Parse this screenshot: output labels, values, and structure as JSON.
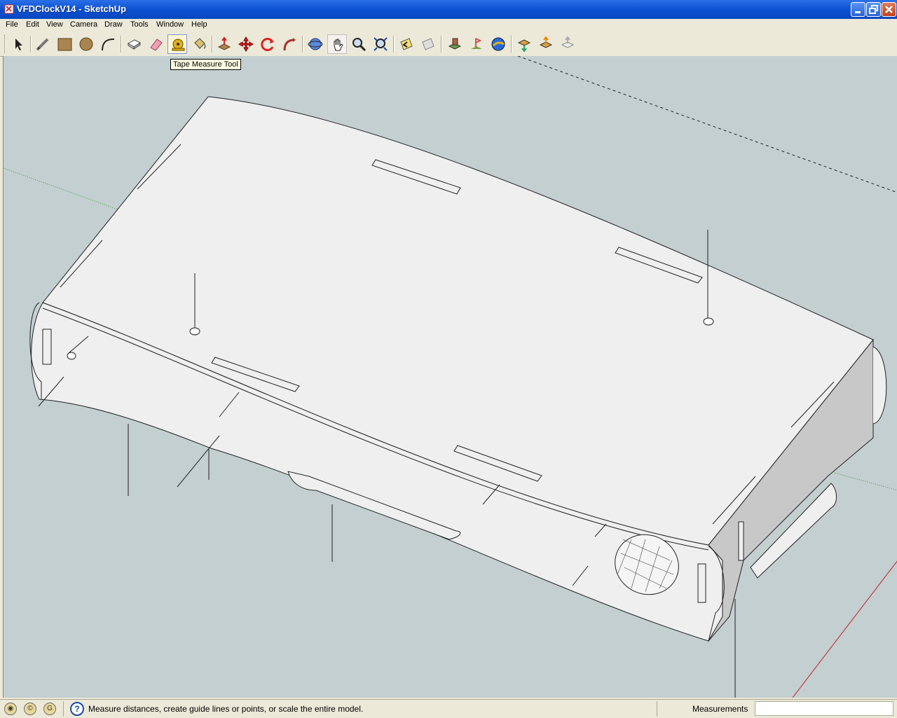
{
  "window": {
    "title": "VFDClockV14 - SketchUp"
  },
  "menu": [
    "File",
    "Edit",
    "View",
    "Camera",
    "Draw",
    "Tools",
    "Window",
    "Help"
  ],
  "toolbar": {
    "tools": [
      {
        "name": "select-tool"
      },
      {
        "name": "line-tool"
      },
      {
        "name": "rectangle-tool"
      },
      {
        "name": "circle-tool"
      },
      {
        "name": "arc-tool"
      },
      {
        "name": "make-component-tool"
      },
      {
        "name": "eraser-tool"
      },
      {
        "name": "tape-measure-tool",
        "active": true
      },
      {
        "name": "paint-bucket-tool"
      },
      {
        "name": "push-pull-tool"
      },
      {
        "name": "move-tool"
      },
      {
        "name": "rotate-tool"
      },
      {
        "name": "follow-me-tool"
      },
      {
        "name": "orbit-tool"
      },
      {
        "name": "pan-tool"
      },
      {
        "name": "zoom-tool"
      },
      {
        "name": "zoom-extents-tool"
      },
      {
        "name": "previous-view-tool"
      },
      {
        "name": "next-view-tool"
      },
      {
        "name": "add-location-tool"
      },
      {
        "name": "toggle-terrain-tool"
      },
      {
        "name": "google-earth-tool"
      },
      {
        "name": "get-models-tool"
      },
      {
        "name": "share-model-tool"
      },
      {
        "name": "share-component-tool"
      }
    ],
    "tooltip": "Tape Measure Tool"
  },
  "status": {
    "icons": [
      "geo-location-icon",
      "credits-icon",
      "google-sign-in-icon"
    ],
    "hint": "Measure distances, create guide lines or points, or scale the entire model.",
    "measurements_label": "Measurements",
    "measurements_value": ""
  },
  "colors": {
    "viewport_bg": "#c3cfd0",
    "titlebar": "#0a4fd0",
    "face": "#efefef",
    "side_face": "#c8c8c8"
  }
}
